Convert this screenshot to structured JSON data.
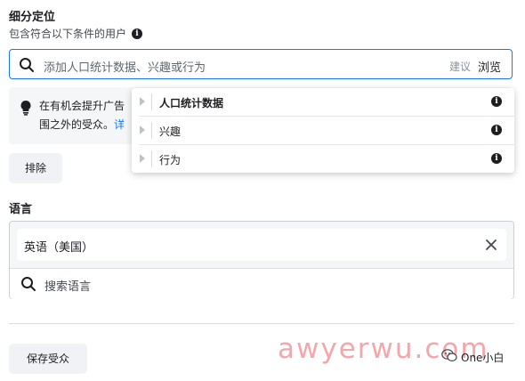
{
  "detailed_targeting": {
    "title": "细分定位",
    "subtitle": "包含符合以下条件的用户",
    "search": {
      "placeholder": "添加人口统计数据、兴趣或行为",
      "suggest_label": "建议",
      "browse_label": "浏览"
    },
    "tip": {
      "line1": "在有机会提升广告",
      "line2": "围之外的受众。",
      "link_text": "详"
    },
    "exclude_button": "排除",
    "dropdown": {
      "items": [
        {
          "label": "人口统计数据",
          "icon": "info-icon"
        },
        {
          "label": "兴趣",
          "icon": "info-icon"
        },
        {
          "label": "行为",
          "icon": "info-icon"
        }
      ]
    }
  },
  "language": {
    "title": "语言",
    "selected": "英语（美国）",
    "search_placeholder": "搜索语言"
  },
  "save_button": "保存受众",
  "watermark": {
    "text": "awyerwu.com",
    "account": "One小白"
  },
  "colors": {
    "accent": "#1877f2",
    "watermark": "#f4a7aa",
    "button_bg": "#f0f2f5"
  }
}
